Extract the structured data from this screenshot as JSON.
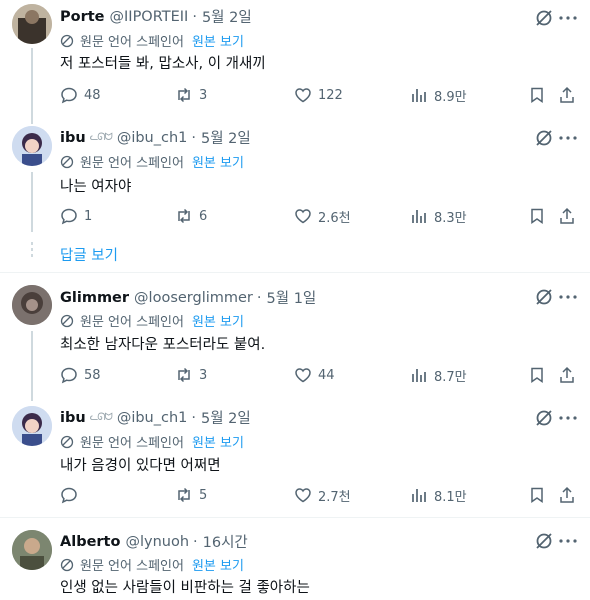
{
  "translate_label": "원문 언어 스페인어",
  "show_original": "원본 보기",
  "show_replies": "답글 보기",
  "dot": "·",
  "tweets": [
    {
      "name": "Porte",
      "badge": "",
      "handle": "@IIPORTEII",
      "time": "5월 2일",
      "text": "저 포스터들 봐, 맙소사, 이 개새끼",
      "replies": "48",
      "retweets": "3",
      "likes": "122",
      "views": "8.9만"
    },
    {
      "name": "ibu",
      "badge": "ᓚᘏᗢ",
      "handle": "@ibu_ch1",
      "time": "5월 2일",
      "text": "나는 여자야",
      "replies": "1",
      "retweets": "6",
      "likes": "2.6천",
      "views": "8.3만"
    },
    {
      "name": "Glimmer",
      "badge": "",
      "handle": "@looserglimmer",
      "time": "5월 1일",
      "text": "최소한 남자다운 포스터라도 붙여.",
      "replies": "58",
      "retweets": "3",
      "likes": "44",
      "views": "8.7만"
    },
    {
      "name": "ibu",
      "badge": "ᓚᘏᗢ",
      "handle": "@ibu_ch1",
      "time": "5월 2일",
      "text": "내가 음경이 있다면 어쩌면",
      "replies": "",
      "retweets": "5",
      "likes": "2.7천",
      "views": "8.1만"
    },
    {
      "name": "Alberto",
      "badge": "",
      "handle": "@lynuoh",
      "time": "16시간",
      "text": "인생 없는 사람들이 비판하는 걸 좋아하는",
      "replies": "",
      "retweets": "",
      "likes": "",
      "views": ""
    }
  ]
}
